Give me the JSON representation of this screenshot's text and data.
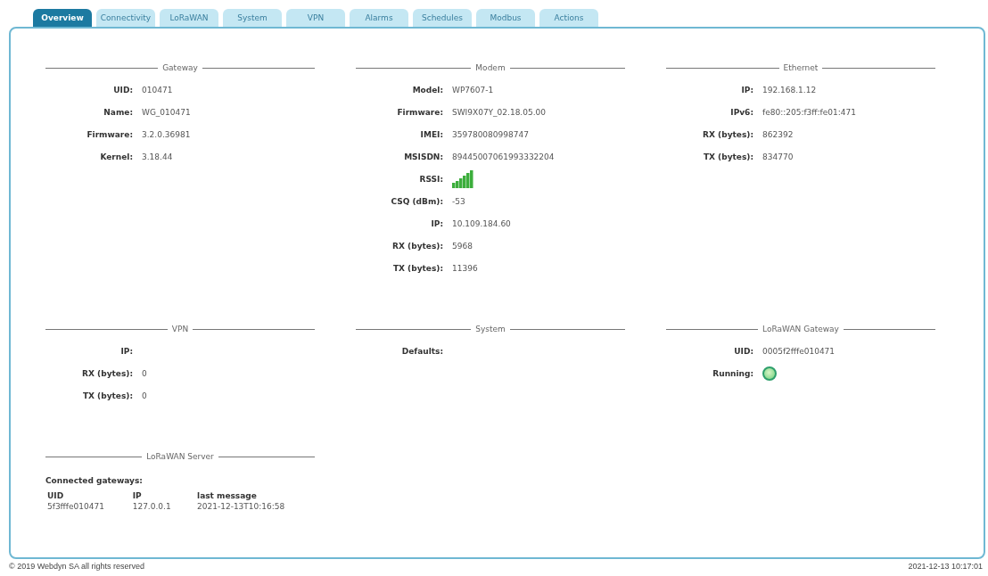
{
  "tabs": [
    {
      "label": "Overview",
      "selected": true
    },
    {
      "label": "Connectivity",
      "selected": false
    },
    {
      "label": "LoRaWAN",
      "selected": false
    },
    {
      "label": "System",
      "selected": false
    },
    {
      "label": "VPN",
      "selected": false
    },
    {
      "label": "Alarms",
      "selected": false
    },
    {
      "label": "Schedules",
      "selected": false
    },
    {
      "label": "Modbus",
      "selected": false
    },
    {
      "label": "Actions",
      "selected": false
    }
  ],
  "sections": [
    {
      "title": "Gateway",
      "rows": [
        {
          "kind": "text",
          "label": "UID:",
          "value": "010471"
        },
        {
          "kind": "text",
          "label": "Name:",
          "value": "WG_010471"
        },
        {
          "kind": "text",
          "label": "Firmware:",
          "value": "3.2.0.36981"
        },
        {
          "kind": "text",
          "label": "Kernel:",
          "value": "3.18.44"
        }
      ]
    },
    {
      "title": "Modem",
      "rows": [
        {
          "kind": "text",
          "label": "Model:",
          "value": "WP7607-1"
        },
        {
          "kind": "text",
          "label": "Firmware:",
          "value": "SWI9X07Y_02.18.05.00"
        },
        {
          "kind": "text",
          "label": "IMEI:",
          "value": "359780080998747"
        },
        {
          "kind": "text",
          "label": "MSISDN:",
          "value": "89445007061993332204"
        },
        {
          "kind": "signal",
          "label": "RSSI:"
        },
        {
          "kind": "text",
          "label": "CSQ (dBm):",
          "value": "-53"
        },
        {
          "kind": "text",
          "label": "IP:",
          "value": "10.109.184.60"
        },
        {
          "kind": "text",
          "label": "RX (bytes):",
          "value": "5968"
        },
        {
          "kind": "text",
          "label": "TX (bytes):",
          "value": "11396"
        }
      ]
    },
    {
      "title": "Ethernet",
      "rows": [
        {
          "kind": "text",
          "label": "IP:",
          "value": "192.168.1.12"
        },
        {
          "kind": "text",
          "label": "IPv6:",
          "value": "fe80::205:f3ff:fe01:471"
        },
        {
          "kind": "text",
          "label": "RX (bytes):",
          "value": "862392"
        },
        {
          "kind": "text",
          "label": "TX (bytes):",
          "value": "834770"
        }
      ]
    },
    {
      "title": "VPN",
      "rows": [
        {
          "kind": "text",
          "label": "IP:"
        },
        {
          "kind": "text",
          "label": "RX (bytes):",
          "value": "0"
        },
        {
          "kind": "text",
          "label": "TX (bytes):",
          "value": "0"
        }
      ]
    },
    {
      "title": "System",
      "rows": [
        {
          "kind": "text",
          "label": "Defaults:"
        }
      ]
    },
    {
      "title": "LoRaWAN Gateway",
      "rows": [
        {
          "kind": "text",
          "label": "UID:",
          "value": "0005f2fffe010471"
        },
        {
          "kind": "status",
          "label": "Running:",
          "on": true
        }
      ]
    }
  ],
  "lorawan_server": {
    "title": "LoRaWAN Server",
    "subtitle": "Connected gateways:",
    "columns": [
      "UID",
      "IP",
      "last message"
    ],
    "rows": [
      [
        "5f3fffe010471",
        "127.0.0.1",
        "2021-12-13T10:16:58"
      ]
    ]
  },
  "footer": {
    "copyright": "© 2019 Webdyn SA all rights reserved",
    "datetime": "2021-12-13 10:17:01"
  }
}
